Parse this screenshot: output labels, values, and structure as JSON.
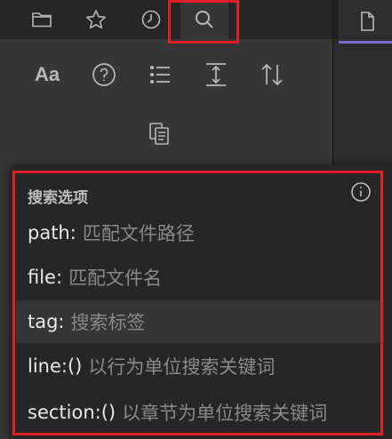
{
  "sidebar": {
    "tabs": [
      {
        "icon": "folder-icon"
      },
      {
        "icon": "star-icon"
      },
      {
        "icon": "clock-icon"
      },
      {
        "icon": "search-icon",
        "active": true
      }
    ],
    "tools": [
      {
        "icon": "match-case-icon",
        "text": "Aa"
      },
      {
        "icon": "help-icon"
      },
      {
        "icon": "list-icon"
      },
      {
        "icon": "expand-vertical-icon"
      },
      {
        "icon": "sort-icon"
      },
      {
        "icon": "copy-results-icon"
      }
    ]
  },
  "right_pane": {
    "tab_icon": "file-icon",
    "accent": "#7a6ccc"
  },
  "popup": {
    "title": "搜索选项",
    "options": [
      {
        "key": "path:",
        "desc": "匹配文件路径"
      },
      {
        "key": "file:",
        "desc": "匹配文件名"
      },
      {
        "key": "tag:",
        "desc": "搜索标签"
      },
      {
        "key": "line:()",
        "desc": "以行为单位搜索关键词"
      },
      {
        "key": "section:()",
        "desc": "以章节为单位搜索关键词"
      }
    ]
  },
  "colors": {
    "highlight_box": "#e21f26",
    "icon": "#b9b9b9"
  }
}
